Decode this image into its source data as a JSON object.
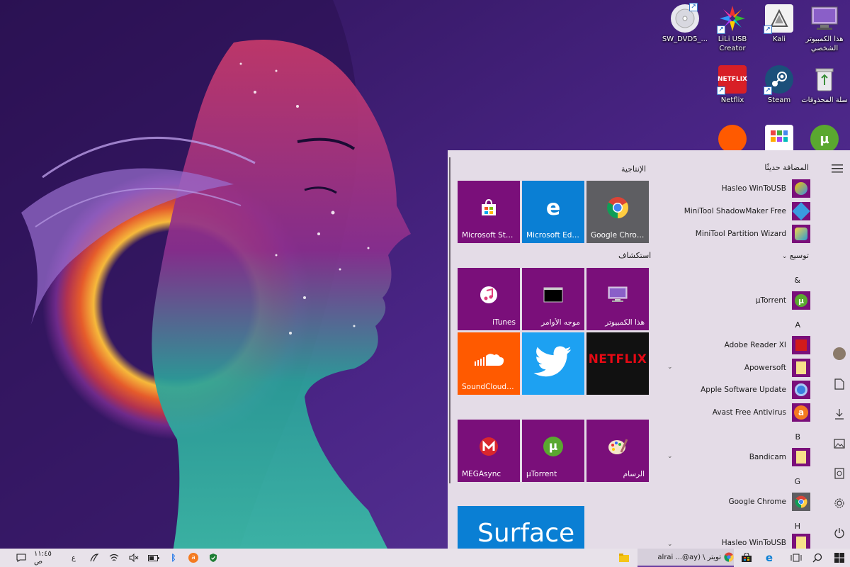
{
  "desktop": {
    "icons": [
      {
        "label": "SW_DVD5_...",
        "icon": "disc-icon"
      },
      {
        "label": "LiLi USB Creator",
        "icon": "lili-icon"
      },
      {
        "label": "Kali",
        "icon": "kali-icon"
      },
      {
        "label": "هذا الكمبيوتر الشخصي",
        "icon": "computer-icon"
      },
      {
        "label": "Netflix",
        "icon": "netflix-icon",
        "glyph": "NETFLIX"
      },
      {
        "label": "Steam",
        "icon": "steam-icon"
      },
      {
        "label": "سلة المحذوفات",
        "icon": "recycle-bin-icon"
      }
    ]
  },
  "start_menu": {
    "groups": [
      {
        "title": "الإنتاجية"
      },
      {
        "title": "استكشاف"
      }
    ],
    "tiles": [
      {
        "label": "Microsoft Store",
        "color": "#7a0f7a"
      },
      {
        "label": "Microsoft Edge",
        "color": "#0a7fd4"
      },
      {
        "label": "Google Chrome",
        "color": "#5e5e62"
      },
      {
        "label": "iTunes",
        "color": "#7a0f7a"
      },
      {
        "label": "موجه الأوامر",
        "color": "#7a0f7a"
      },
      {
        "label": "هذا الكمبيوتر",
        "color": "#7a0f7a"
      },
      {
        "label": "SoundCloud f...",
        "color": "#ff5a00"
      },
      {
        "label": "",
        "color": "#1da1f2"
      },
      {
        "label": "",
        "color": "#111111",
        "glyph": "NETFLIX"
      },
      {
        "label": "MEGAsync",
        "color": "#7a0f7a"
      },
      {
        "label": "µTorrent",
        "color": "#7a0f7a"
      },
      {
        "label": "الرسام",
        "color": "#7a0f7a"
      }
    ],
    "surface_tile": {
      "label": "Surface",
      "color": "#0a7fd4"
    },
    "recently_added_title": "المضافة حديثًا",
    "recent": [
      {
        "label": "Hasleo WinToUSB"
      },
      {
        "label": "MiniTool ShadowMaker Free"
      },
      {
        "label": "MiniTool Partition Wizard"
      }
    ],
    "expand_label": "توسيع",
    "sections": [
      {
        "letter": "&",
        "apps": [
          {
            "label": "µTorrent",
            "glyph": "µ"
          }
        ]
      },
      {
        "letter": "A",
        "apps": [
          {
            "label": "Adobe Reader XI"
          },
          {
            "label": "Apowersoft"
          },
          {
            "label": "Apple Software Update"
          },
          {
            "label": "Avast Free Antivirus"
          }
        ]
      },
      {
        "letter": "B",
        "apps": [
          {
            "label": "Bandicam"
          }
        ]
      },
      {
        "letter": "G",
        "apps": [
          {
            "label": "Google Chrome"
          }
        ]
      },
      {
        "letter": "H",
        "apps": [
          {
            "label": "Hasleo WinToUSB"
          }
        ]
      }
    ]
  },
  "taskbar": {
    "clock": "١١:٤٥ ص",
    "lang": "ع",
    "chrome_window_title": "تويتر \\ (alrai ...@ay"
  },
  "colors": {
    "tile_purple": "#7a0f7a",
    "menu_bg": "#e4dce7",
    "taskbar_bg": "#e8e2ea"
  }
}
